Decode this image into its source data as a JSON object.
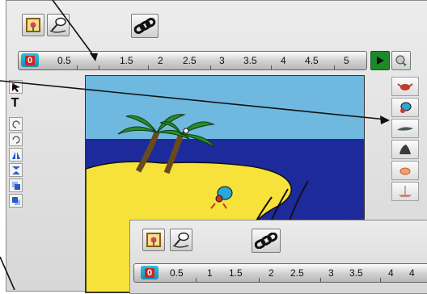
{
  "app": {
    "timeline": {
      "current_frame": "0",
      "labels": [
        "0.5",
        "1.5",
        "2",
        "2.5",
        "3",
        "3.5",
        "4",
        "4.5",
        "5"
      ]
    },
    "overlay_timeline": {
      "current_frame": "0",
      "labels": [
        "0.5",
        "1",
        "1.5",
        "2",
        "2.5",
        "3",
        "3.5",
        "4",
        "4"
      ]
    },
    "tools": {
      "text_tool_label": "T"
    }
  },
  "icons": [
    "picture-icon",
    "microphone-icon",
    "chain-link-icon",
    "play-icon",
    "record-icon",
    "arrow-tool-icon",
    "text-tool-icon",
    "rotate-ccw-icon",
    "rotate-cw-icon",
    "flip-horizontal-icon",
    "flip-vertical-icon",
    "bring-front-icon",
    "send-back-icon",
    "crab-icon",
    "hermit-crab-icon",
    "lizard-icon",
    "seal-icon",
    "crab-outline-icon",
    "shipwreck-icon"
  ],
  "colors": {
    "sky": "#6fb8e0",
    "sea": "#1d2a9c",
    "sand": "#f6e23a",
    "play_button": "#1c8a2a",
    "timeline_marker": "#d42020"
  }
}
